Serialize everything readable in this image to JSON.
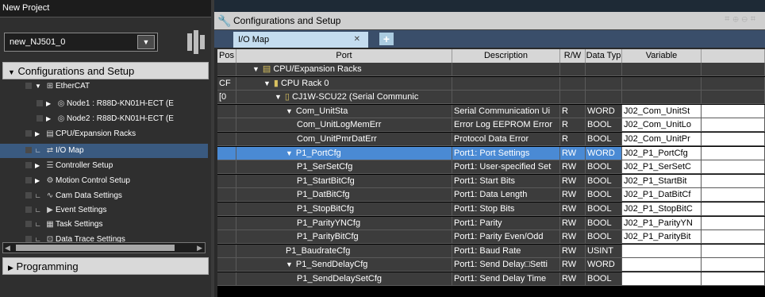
{
  "left": {
    "title": "New Project",
    "project_name": "new_NJ501_0",
    "config_header": "Configurations and Setup",
    "programming_header": "Programming",
    "tree": [
      {
        "label": "EtherCAT",
        "indent": 1,
        "arrow": "▼",
        "icon": "ethercat-icon",
        "glyph": "⊞"
      },
      {
        "label": "Node1 : R88D-KN01H-ECT (E",
        "indent": 2,
        "arrow": "▶",
        "icon": "node-icon",
        "glyph": "◎"
      },
      {
        "label": "Node2 : R88D-KN01H-ECT (E",
        "indent": 2,
        "arrow": "▶",
        "icon": "node-icon",
        "glyph": "◎"
      },
      {
        "label": "CPU/Expansion Racks",
        "indent": 1,
        "arrow": "▶",
        "icon": "rack-icon",
        "glyph": "▤"
      },
      {
        "label": "I/O Map",
        "indent": 1,
        "arrow": "∟",
        "icon": "io-map-icon",
        "glyph": "⇄",
        "selected": true
      },
      {
        "label": "Controller Setup",
        "indent": 1,
        "arrow": "▶",
        "icon": "controller-icon",
        "glyph": "☰"
      },
      {
        "label": "Motion Control Setup",
        "indent": 1,
        "arrow": "▶",
        "icon": "motion-icon",
        "glyph": "⚙"
      },
      {
        "label": "Cam Data Settings",
        "indent": 1,
        "arrow": "∟",
        "icon": "cam-icon",
        "glyph": "∿"
      },
      {
        "label": "Event Settings",
        "indent": 1,
        "arrow": "∟",
        "icon": "event-icon",
        "glyph": "▶"
      },
      {
        "label": "Task Settings",
        "indent": 1,
        "arrow": "∟",
        "icon": "task-icon",
        "glyph": "▦"
      },
      {
        "label": "Data Trace Settings",
        "indent": 1,
        "arrow": "∟",
        "icon": "trace-icon",
        "glyph": "⊡"
      }
    ]
  },
  "right": {
    "title": "Configurations and Setup",
    "tab_label": "I/O Map",
    "columns": [
      "Pos",
      "Port",
      "Description",
      "R/W",
      "Data Typ",
      "Variable"
    ],
    "rows": [
      {
        "pos": "",
        "port": "CPU/Expansion Racks",
        "port_indent": 1,
        "arrow": "▼",
        "icon": "rack-icon",
        "glyph": "▤",
        "desc": "",
        "rw": "",
        "type": "",
        "var": "",
        "varcell": false
      },
      {
        "pos": "CF",
        "port": "CPU Rack 0",
        "port_indent": 2,
        "arrow": "▼",
        "icon": "cpu-rack-icon",
        "glyph": "▮",
        "desc": "",
        "rw": "",
        "type": "",
        "var": "",
        "varcell": false
      },
      {
        "pos": "[0",
        "port": "CJ1W-SCU22 (Serial Communic",
        "port_indent": 3,
        "arrow": "▼",
        "icon": "unit-icon",
        "glyph": "▯",
        "desc": "",
        "rw": "",
        "type": "",
        "var": "",
        "varcell": false
      },
      {
        "pos": "",
        "port": "Com_UnitSta",
        "port_indent": 4,
        "arrow": "▼",
        "desc": "Serial Communication Ui",
        "rw": "R",
        "type": "WORD",
        "var": "J02_Com_UnitSt",
        "varcell": true
      },
      {
        "pos": "",
        "port": "Com_UnitLogMemErr",
        "port_indent": 5,
        "arrow": "",
        "desc": "Error Log EEPROM Error",
        "rw": "R",
        "type": "BOOL",
        "var": "J02_Com_UnitLo",
        "varcell": true
      },
      {
        "pos": "",
        "port": "Com_UnitPmrDatErr",
        "port_indent": 5,
        "arrow": "",
        "desc": "Protocol Data Error",
        "rw": "R",
        "type": "BOOL",
        "var": "J02_Com_UnitPr",
        "varcell": true
      },
      {
        "pos": "",
        "port": "P1_PortCfg",
        "port_indent": 4,
        "arrow": "▼",
        "desc": "Port1: Port Settings",
        "rw": "RW",
        "type": "WORD",
        "var": "J02_P1_PortCfg",
        "varcell": true,
        "selected": true
      },
      {
        "pos": "",
        "port": "P1_SerSetCfg",
        "port_indent": 5,
        "arrow": "",
        "desc": "Port1: User-specified Set",
        "rw": "RW",
        "type": "BOOL",
        "var": "J02_P1_SerSetC",
        "varcell": true
      },
      {
        "pos": "",
        "port": "P1_StartBitCfg",
        "port_indent": 5,
        "arrow": "",
        "desc": "Port1: Start Bits",
        "rw": "RW",
        "type": "BOOL",
        "var": "J02_P1_StartBit",
        "varcell": true
      },
      {
        "pos": "",
        "port": "P1_DatBitCfg",
        "port_indent": 5,
        "arrow": "",
        "desc": "Port1: Data Length",
        "rw": "RW",
        "type": "BOOL",
        "var": "J02_P1_DatBitCf",
        "varcell": true
      },
      {
        "pos": "",
        "port": "P1_StopBitCfg",
        "port_indent": 5,
        "arrow": "",
        "desc": "Port1: Stop Bits",
        "rw": "RW",
        "type": "BOOL",
        "var": "J02_P1_StopBitC",
        "varcell": true
      },
      {
        "pos": "",
        "port": "P1_ParityYNCfg",
        "port_indent": 5,
        "arrow": "",
        "desc": "Port1: Parity",
        "rw": "RW",
        "type": "BOOL",
        "var": "J02_P1_ParityYN",
        "varcell": true
      },
      {
        "pos": "",
        "port": "P1_ParityBitCfg",
        "port_indent": 5,
        "arrow": "",
        "desc": "Port1: Parity Even/Odd",
        "rw": "RW",
        "type": "BOOL",
        "var": "J02_P1_ParityBit",
        "varcell": true
      },
      {
        "pos": "",
        "port": "P1_BaudrateCfg",
        "port_indent": 4,
        "arrow": "",
        "desc": "Port1: Baud Rate",
        "rw": "RW",
        "type": "USINT",
        "var": "",
        "varcell": true
      },
      {
        "pos": "",
        "port": "P1_SendDelayCfg",
        "port_indent": 4,
        "arrow": "▼",
        "desc": "Port1: Send Delay□Setti",
        "rw": "RW",
        "type": "WORD",
        "var": "",
        "varcell": true
      },
      {
        "pos": "",
        "port": "P1_SendDelaySetCfg",
        "port_indent": 5,
        "arrow": "",
        "desc": "Port1: Send Delay Time",
        "rw": "RW",
        "type": "BOOL",
        "var": "",
        "varcell": true
      }
    ]
  }
}
